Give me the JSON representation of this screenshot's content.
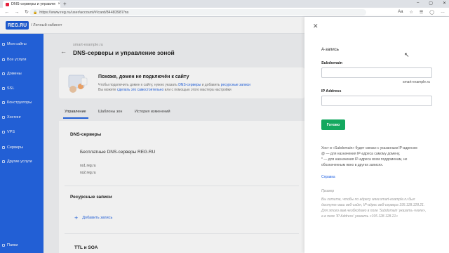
{
  "browser": {
    "tab_title": "DNS-серверы и управление зо",
    "tab_close": "×",
    "new_tab": "+",
    "window_controls": [
      "–",
      "▢",
      "✕"
    ],
    "url": "https://www.reg.ru/user/account/#/card/84483987/ns",
    "nav": [
      "←",
      "→",
      "↻"
    ]
  },
  "header": {
    "logo": "REG.RU",
    "cabinet": "/ Личный кабинет"
  },
  "sidebar": {
    "items": [
      {
        "label": "Мои сайты",
        "icon": "globe-icon"
      },
      {
        "label": "Все услуги",
        "icon": "grid-icon"
      },
      {
        "label": "Домены",
        "icon": "domain-icon"
      },
      {
        "label": "SSL",
        "icon": "lock-icon"
      },
      {
        "label": "Конструкторы",
        "icon": "builder-icon"
      },
      {
        "label": "Хостинг",
        "icon": "hosting-icon"
      },
      {
        "label": "VPS",
        "icon": "server-icon"
      },
      {
        "label": "Серверы",
        "icon": "servers-icon"
      },
      {
        "label": "Другие услуги",
        "icon": "more-icon"
      },
      {
        "label": "Папки",
        "icon": "folder-icon"
      }
    ]
  },
  "main": {
    "domain": "smart-example.ru",
    "title": "DNS-серверы и управление зоной",
    "alert": {
      "title": "Похоже, домен не подключён к сайту",
      "text1_a": "Чтобы подключить домен к сайту, нужно указать ",
      "text1_link1": "DNS-серверы",
      "text1_b": " и добавить ",
      "text1_link2": "ресурсные записи",
      "text2_a": "Вы можете ",
      "text2_link": "сделать это самостоятельно",
      "text2_b": " или с помощью этого мастера настройки"
    },
    "tabs": [
      "Управление",
      "Шаблоны зон",
      "История изменений"
    ],
    "dns_heading": "DNS-серверы",
    "dns_free": "Бесплатные DNS-серверы REG.RU",
    "ns": [
      "ns1.reg.ru",
      "ns2.reg.ru"
    ],
    "records_heading": "Ресурсные записи",
    "add_record": "Добавить запись",
    "ttl_heading": "TTL и SOA"
  },
  "panel": {
    "title": "А-запись",
    "subdomain_label": "Subdomain",
    "subdomain_value": "",
    "subdomain_suffix": "smart-example.ru",
    "ip_label": "IP Address",
    "ip_value": "",
    "submit": "Готово",
    "help": [
      "Хост в «Subdomain» будет связан с указанным IP-адресом",
      "@ — для назначения IP-адреса самому домену,",
      "* — для назначения IP-адреса всем поддоменам, не",
      "обозначенным явно в других записях."
    ],
    "help_link": "Справка",
    "example_title": "Пример",
    "example": [
      "Вы хотите, чтобы по адресу www.smart-example.ru был",
      "доступен ваш веб-сайт, IP-адрес веб-сервера 195.128.128.21.",
      "Для этого вам необходимо в поле 'Subdomain' указать «www»,",
      "а в поле 'IP Address' указать «195.128.128.21»"
    ]
  }
}
